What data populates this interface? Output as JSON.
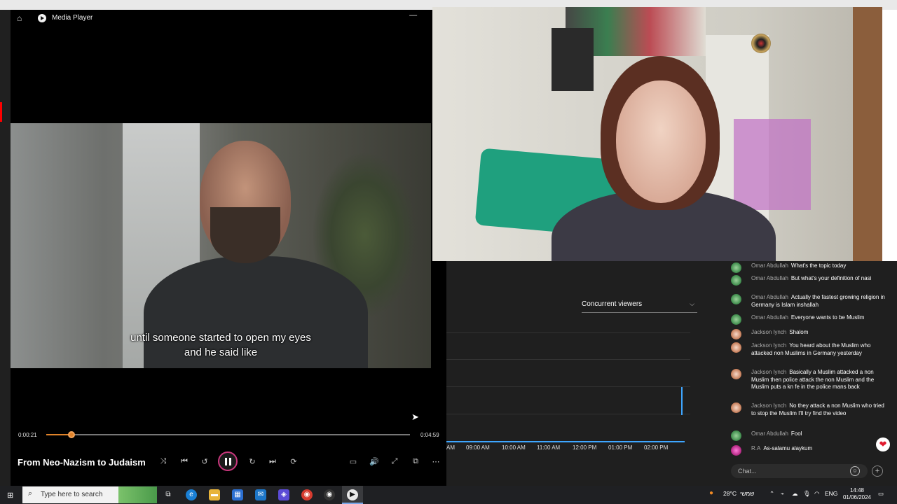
{
  "media_player": {
    "app_title": "Media Player",
    "captions": [
      "until someone started to open my eyes",
      "and he said like"
    ],
    "time_current": "0:00:21",
    "time_total": "0:04:59",
    "progress": 0.07,
    "song_title": "From Neo-Nazism to Judaism"
  },
  "analytics": {
    "dropdown_label": "Concurrent viewers",
    "time_ticks": [
      "AM",
      "09:00 AM",
      "10:00 AM",
      "11:00 AM",
      "12:00 PM",
      "01:00 PM",
      "02:00 PM"
    ]
  },
  "chat": {
    "messages": [
      {
        "author": "Omar Abdullah",
        "text": "What's the topic today",
        "avatar": "green"
      },
      {
        "author": "Omar Abdullah",
        "text": "But what's your definition of nasi",
        "avatar": "green"
      },
      {
        "author": "Omar Abdullah",
        "text": "Actually the fastest growing religion in Germany is Islam inshallah",
        "avatar": "green"
      },
      {
        "author": "Omar Abdullah",
        "text": "Everyone wants to be Muslim",
        "avatar": "green"
      },
      {
        "author": "Jackson lynch",
        "text": "Shalom",
        "avatar": "jack"
      },
      {
        "author": "Jackson lynch",
        "text": "You heard about the Muslim who attacked non Muslims in Germany yesterday",
        "avatar": "jack"
      },
      {
        "author": "Jackson lynch",
        "text": "Basically a Muslim attacked a non Muslim then police attack the non Muslim and the Muslim puts a kn fe in the police mans back",
        "avatar": "jack"
      },
      {
        "author": "Jackson lynch",
        "text": "No they attack a non Muslim who tried to stop the Muslim I'll try find the video",
        "avatar": "jack"
      },
      {
        "author": "Omar Abdullah",
        "text": "Fool",
        "avatar": "green"
      },
      {
        "author": "R.A",
        "text": "As-salamu alaykum",
        "avatar": "ra"
      }
    ],
    "input_placeholder": "Chat..."
  },
  "taskbar": {
    "search_placeholder": "Type here to search",
    "weather": "28°C",
    "weather_desc": "שמשי",
    "language": "ENG",
    "time": "14:48",
    "date": "01/06/2024"
  },
  "colors": {
    "accent": "#e0832a",
    "play_ring": "#c9377d",
    "chart_line": "#3ea6ff"
  }
}
